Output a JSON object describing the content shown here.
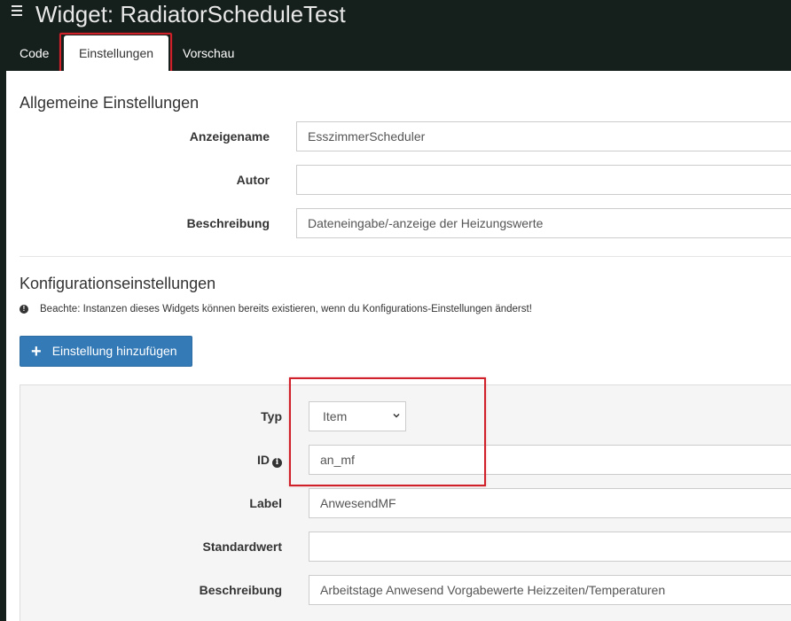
{
  "header": {
    "title": "Widget: RadiatorScheduleTest",
    "menu_icon": "hamburger-icon"
  },
  "tabs": [
    {
      "label": "Code",
      "active": false
    },
    {
      "label": "Einstellungen",
      "active": true
    },
    {
      "label": "Vorschau",
      "active": false
    }
  ],
  "general": {
    "heading": "Allgemeine Einstellungen",
    "fields": [
      {
        "label": "Anzeigename",
        "value": "EsszimmerScheduler"
      },
      {
        "label": "Autor",
        "value": ""
      },
      {
        "label": "Beschreibung",
        "value": "Dateneingabe/-anzeige der Heizungswerte"
      }
    ]
  },
  "config": {
    "heading": "Konfigurationseinstellungen",
    "warning": "Beachte: Instanzen dieses Widgets können bereits existieren, wenn du Konfigurations-Einstellungen änderst!",
    "add_button": "Einstellung hinzufügen",
    "setting": {
      "typ_label": "Typ",
      "typ_value": "Item",
      "id_label": "ID",
      "id_value": "an_mf",
      "label_label": "Label",
      "label_value": "AnwesendMF",
      "default_label": "Standardwert",
      "default_value": "",
      "desc_label": "Beschreibung",
      "desc_value": "Arbeitstage Anwesend Vorgabewerte Heizzeiten/Temperaturen"
    }
  },
  "colors": {
    "header_bg": "#151f1b",
    "primary": "#337ab7",
    "highlight": "#d0202a"
  }
}
